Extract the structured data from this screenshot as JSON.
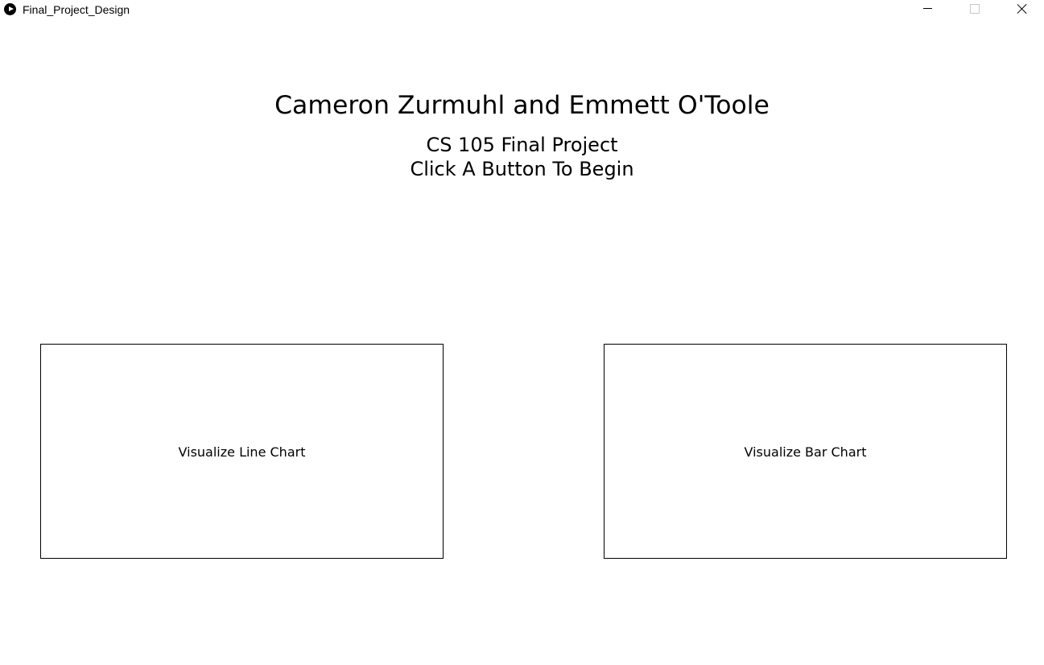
{
  "window": {
    "title": "Final_Project_Design",
    "app_icon": "processing-play-icon",
    "controls": {
      "minimize_icon": "minimize-icon",
      "maximize_icon": "maximize-icon",
      "close_icon": "close-icon"
    }
  },
  "content": {
    "title": "Cameron Zurmuhl and Emmett O'Toole",
    "subtitle": "CS 105 Final Project",
    "instruction": "Click A Button To Begin"
  },
  "buttons": {
    "line_chart": "Visualize Line Chart",
    "bar_chart": "Visualize Bar Chart"
  },
  "colors": {
    "background": "#ffffff",
    "text": "#000000",
    "border": "#000000"
  }
}
